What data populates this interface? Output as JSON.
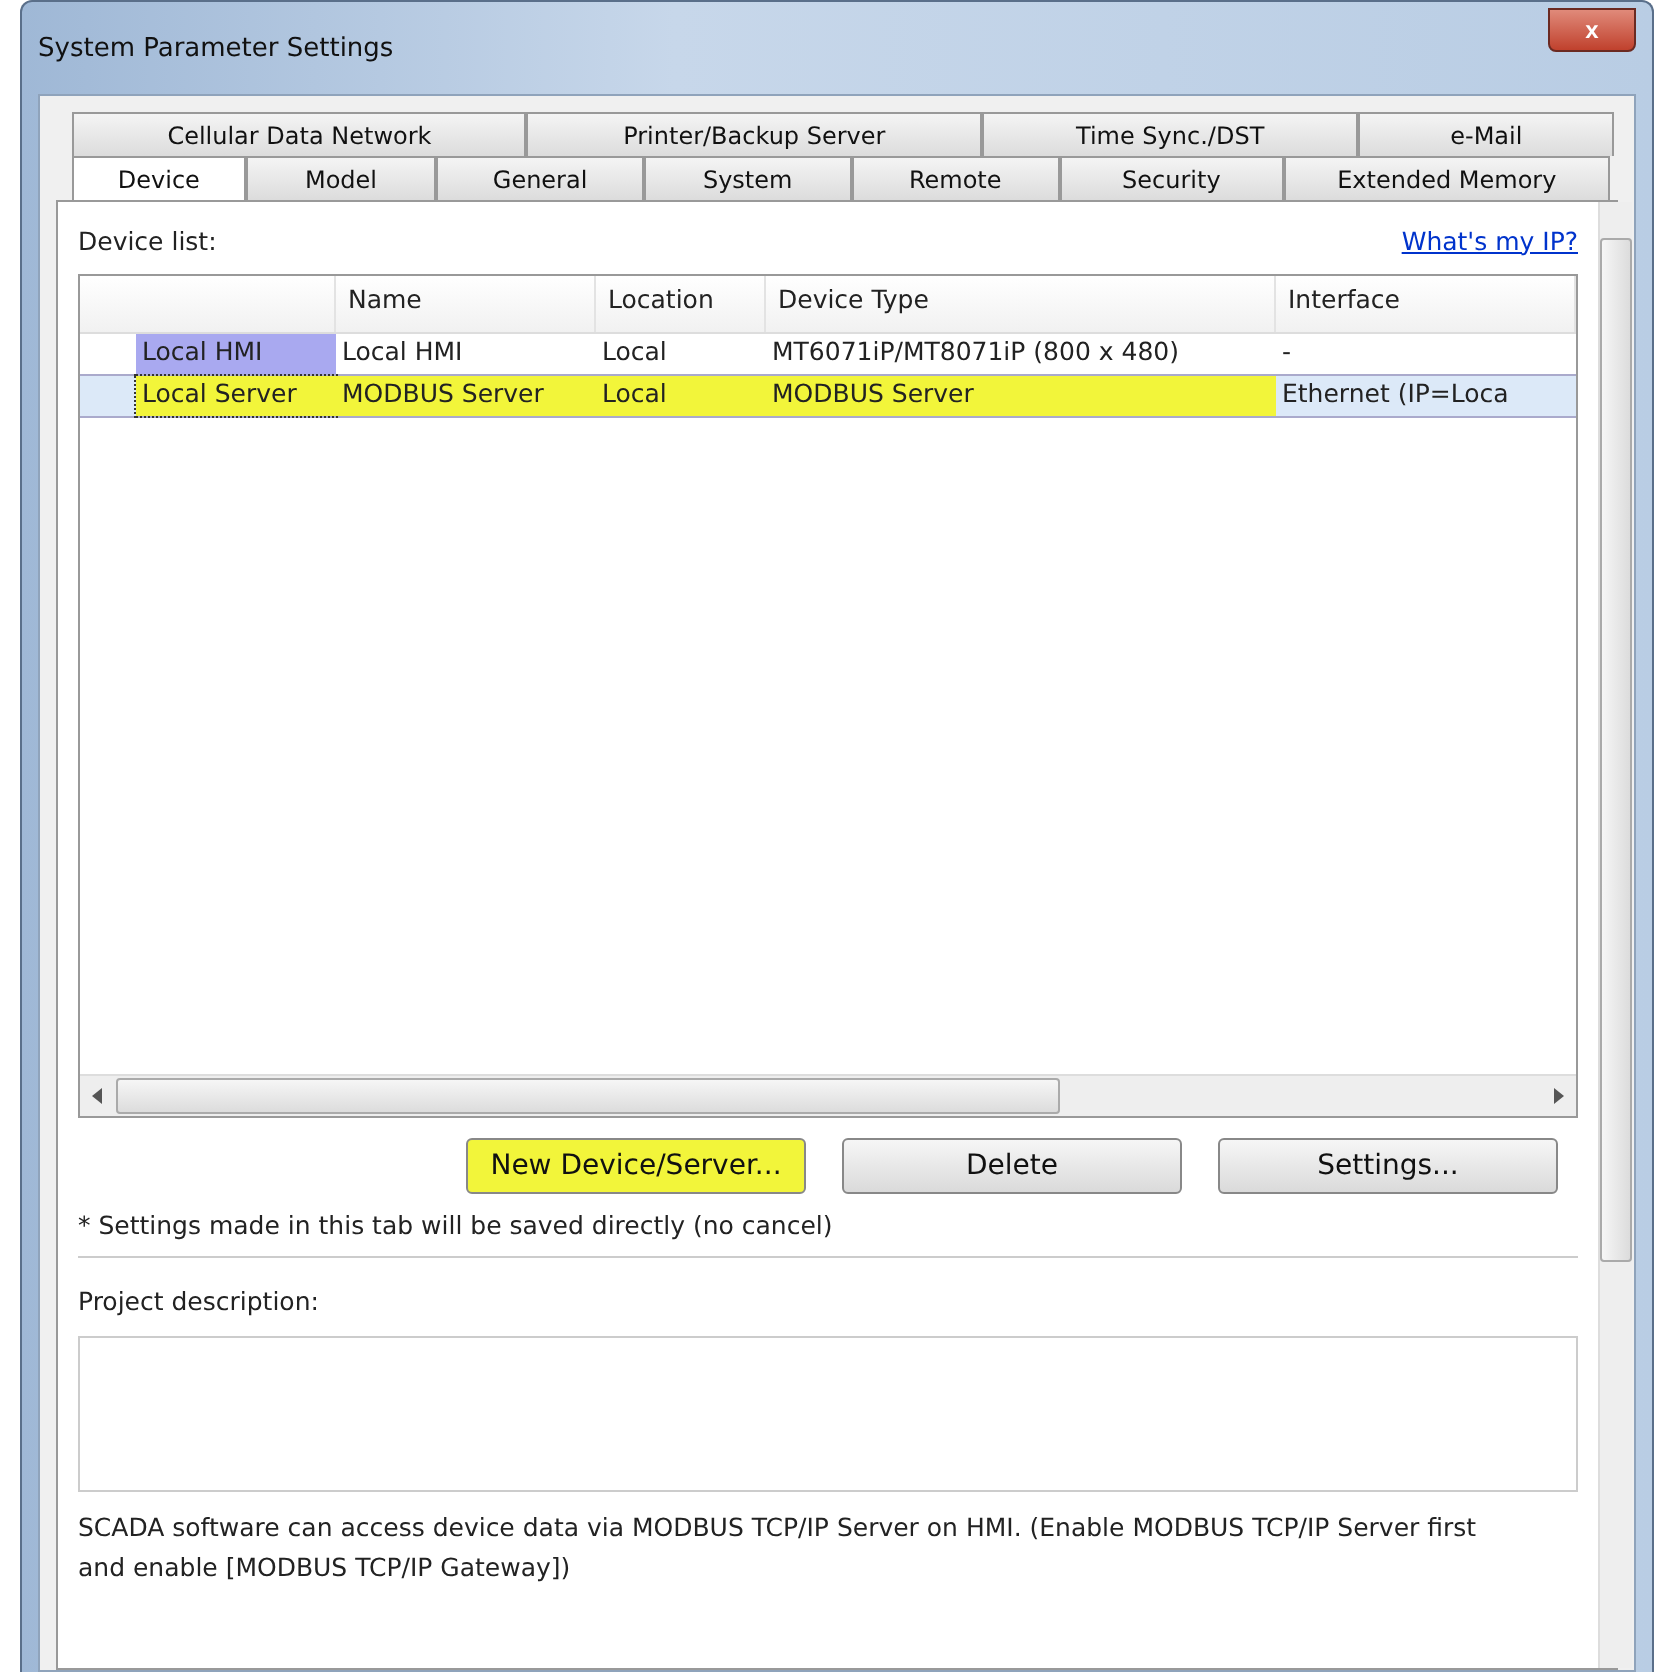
{
  "window": {
    "title": "System Parameter Settings",
    "close": "x"
  },
  "tab_rows": [
    [
      {
        "label": "Cellular Data Network",
        "selected": false
      },
      {
        "label": "Printer/Backup Server",
        "selected": false
      },
      {
        "label": "Time Sync./DST",
        "selected": false
      },
      {
        "label": "e-Mail",
        "selected": false
      }
    ],
    [
      {
        "label": "Device",
        "selected": true
      },
      {
        "label": "Model",
        "selected": false
      },
      {
        "label": "General",
        "selected": false
      },
      {
        "label": "System",
        "selected": false
      },
      {
        "label": "Remote",
        "selected": false
      },
      {
        "label": "Security",
        "selected": false
      },
      {
        "label": "Extended Memory",
        "selected": false
      }
    ]
  ],
  "device_list": {
    "label": "Device list:",
    "link": "What's my IP?",
    "columns": [
      "",
      "Name",
      "Location",
      "Device Type",
      "Interface"
    ],
    "rows": [
      {
        "cells": [
          "Local HMI",
          "Local HMI",
          "Local",
          "MT6071iP/MT8071iP (800 x 480)",
          "-"
        ],
        "selected": false,
        "highlighted": false
      },
      {
        "cells": [
          "Local Server",
          "MODBUS Server",
          "Local",
          "MODBUS Server",
          "Ethernet (IP=Loca"
        ],
        "selected": true,
        "highlighted": true
      }
    ]
  },
  "buttons": [
    {
      "label": "New Device/Server...",
      "highlighted": true
    },
    {
      "label": "Delete",
      "highlighted": false
    },
    {
      "label": "Settings...",
      "highlighted": false
    }
  ],
  "note": "* Settings made in this tab will be saved directly (no cancel)",
  "project_description": {
    "label": "Project description:"
  },
  "footer": "SCADA software can access device data via MODBUS TCP/IP Server on HMI. (Enable MODBUS TCP/IP Server first and enable [MODBUS TCP/IP Gateway])"
}
